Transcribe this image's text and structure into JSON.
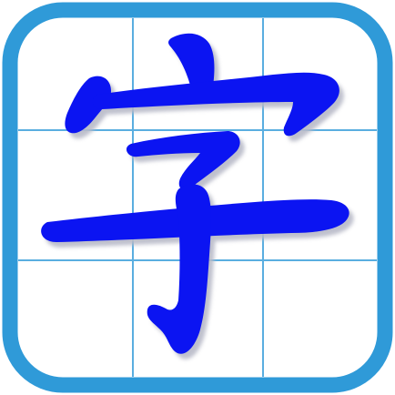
{
  "icon": {
    "name": "hanzi-writing-app-icon",
    "glyph": "字",
    "colors": {
      "frame": "#2f9ad8",
      "grid": "#5aaee0",
      "background": "#ffffff",
      "character": "#0b14f2",
      "character_shadow": "#b8bac8"
    }
  }
}
